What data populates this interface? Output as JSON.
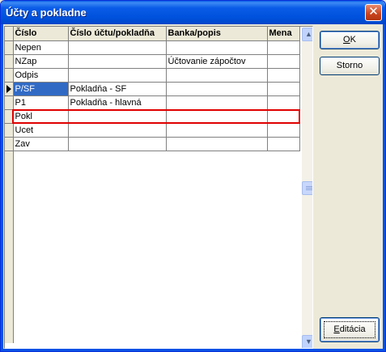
{
  "window": {
    "title": "Účty a pokladne",
    "close_label": "✕"
  },
  "grid": {
    "columns": [
      "Číslo",
      "Číslo účtu/pokladňa",
      "Banka/popis",
      "Mena"
    ],
    "rows": [
      {
        "code": "Nepen",
        "account": "",
        "bank": "",
        "currency": ""
      },
      {
        "code": "NZap",
        "account": "",
        "bank": "Účtovanie zápočtov",
        "currency": ""
      },
      {
        "code": "Odpis",
        "account": "",
        "bank": "",
        "currency": ""
      },
      {
        "code": "P/SF",
        "account": "Pokladňa - SF",
        "bank": "",
        "currency": ""
      },
      {
        "code": "P1",
        "account": "Pokladňa - hlavná",
        "bank": "",
        "currency": ""
      },
      {
        "code": "Pokl",
        "account": "",
        "bank": "",
        "currency": ""
      },
      {
        "code": "Ucet",
        "account": "",
        "bank": "",
        "currency": ""
      },
      {
        "code": "Zav",
        "account": "",
        "bank": "",
        "currency": ""
      }
    ],
    "selected_index": 3
  },
  "buttons": {
    "ok_label": "OK",
    "ok_mnemonic": "O",
    "ok_rest": "K",
    "storno_label": "Storno",
    "edit_label": "Editácia",
    "edit_mnemonic": "E",
    "edit_rest": "ditácia"
  }
}
